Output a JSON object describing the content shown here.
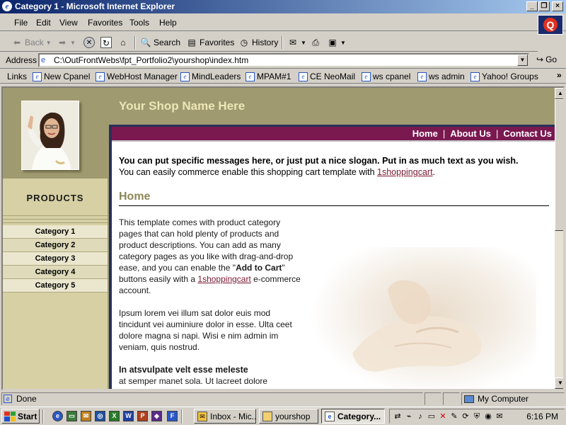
{
  "window": {
    "title": "Category 1 - Microsoft Internet Explorer",
    "controls": [
      "_",
      "❐",
      "×"
    ]
  },
  "menu": [
    "File",
    "Edit",
    "View",
    "Favorites",
    "Tools",
    "Help"
  ],
  "toolbar": {
    "back": "Back",
    "search": "Search",
    "favorites": "Favorites",
    "history": "History"
  },
  "address": {
    "label": "Address",
    "url": "C:\\OutFrontWebs\\fpt_Portfolio2\\yourshop\\index.htm",
    "go": "Go"
  },
  "links": {
    "label": "Links",
    "items": [
      "New Cpanel",
      "WebHost Manager",
      "MindLeaders",
      "MPAM#1",
      "CE NeoMail",
      "ws cpanel",
      "ws admin",
      "Yahoo! Groups"
    ],
    "overflow": "»"
  },
  "page": {
    "shop_name": "Your Shop Name Here",
    "products_title": "PRODUCTS",
    "categories": [
      "Category 1",
      "Category 2",
      "Category 3",
      "Category 4",
      "Category 5"
    ],
    "nav": [
      "Home",
      "About Us",
      "Contact Us"
    ],
    "nav_separator": "|",
    "slogan": "You can put specific messages here, or just put a nice slogan.  Put in as much text as you wish.",
    "commerce_line_prefix": "You can easily commerce enable this shopping cart template with ",
    "commerce_link": "1shoppingcart",
    "commerce_line_suffix": ".",
    "home_heading": "Home",
    "para1_a": "This template comes with product category pages that can hold plenty of products and product descriptions.  You can add as many category pages as you like with drag-and-drop ease, and you can enable the \"",
    "para1_bold": "Add to Cart",
    "para1_b": "\" buttons easily with a ",
    "para1_link": "1shoppingcart",
    "para1_c": " e-commerce account.",
    "para2": "Ipsum lorem vei illum sat dolor euis mod tincidunt vei auminiure dolor in esse. Ulta ceet dolore magna si napi. Wisi e nim admin im veniam, quis nostrud.",
    "subheading": "In atsvulpate velt esse meleste",
    "para3": "at semper manet sola. Ut lacreet dolore"
  },
  "status": {
    "text": "Done",
    "zone": "My Computer"
  },
  "taskbar": {
    "start": "Start",
    "tasks": [
      "Inbox - Mic...",
      "yourshop",
      "Category..."
    ],
    "clock": "6:16 PM"
  },
  "colors": {
    "title_bar": "#0a246a",
    "site_accent": "#7a1850",
    "site_frame": "#26305a",
    "sidebar": "#d6d0a4",
    "header_olive": "#a09a70"
  }
}
